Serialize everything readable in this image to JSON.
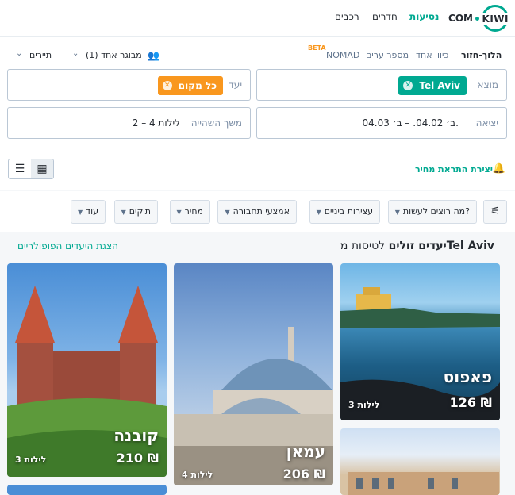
{
  "logo": {
    "kiwi": "KIWI",
    "com": "COM"
  },
  "nav": {
    "flights": "נסיעות",
    "rooms": "חדרים",
    "cars": "רכבים"
  },
  "search": {
    "trip_types": [
      "הלוך-חזור",
      "כיוון אחד",
      "מספר ערים",
      "NOMAD"
    ],
    "beta": "BETA",
    "passengers": "מבוגר אחד (1)",
    "cabin": "תיירים",
    "from_label": "מוצא",
    "from_value": "Tel Aviv",
    "to_label": "יעד",
    "to_value": "כל מקום",
    "depart_label": "יציאה",
    "depart_value": "ב׳ 04.02. – ב׳ 04.03.",
    "stay_label": "משך השהייה",
    "stay_value": "2 – 4 לילות",
    "price_alert": "יצירת התראת מחיר"
  },
  "filters": [
    "מה רוצים לעשות?",
    "עצירות ביניים",
    "אמצעי תחבורה",
    "מחיר",
    "תיקים",
    "עוד"
  ],
  "section": {
    "title_bold": "יעדים זולים",
    "title_rest": " לטיסות מ",
    "title_city": "Tel Aviv",
    "link": "הצגת היעדים הפופולריים"
  },
  "cards": [
    {
      "city": "פאפוס",
      "price": "126 ₪",
      "nights": "3 לילות"
    },
    {
      "city": "עמאן",
      "price": "206 ₪",
      "nights": "4 לילות"
    },
    {
      "city": "קובנה",
      "price": "210 ₪",
      "nights": "3 לילות"
    }
  ],
  "colors": {
    "accent": "#00a991",
    "orange": "#f9971e",
    "text": "#252a31"
  }
}
